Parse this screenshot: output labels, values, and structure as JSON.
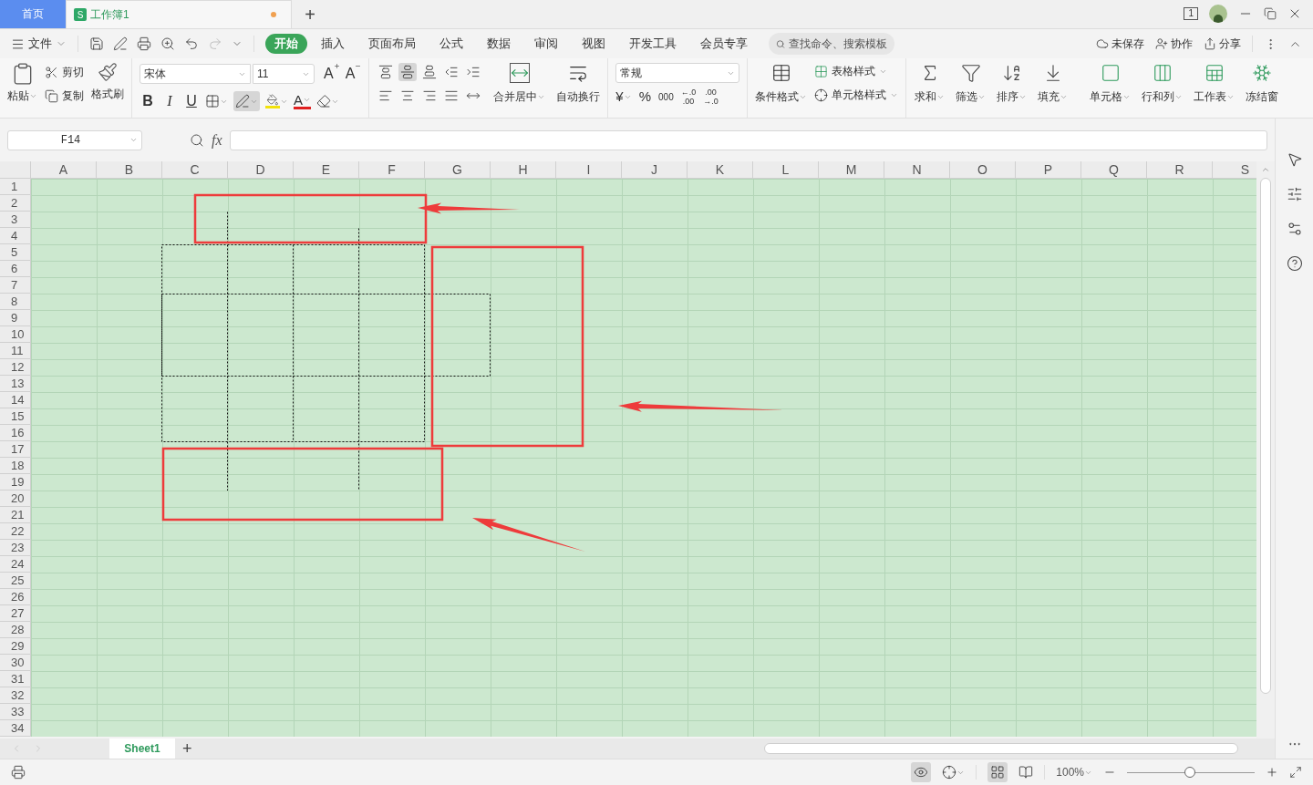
{
  "title_bar": {
    "home_tab": "首页",
    "document_tab": {
      "badge": "S",
      "title": "工作簿1",
      "unsaved": true
    },
    "new_tab_button": "+",
    "window_count": "1"
  },
  "menu_bar": {
    "file_menu": "文件",
    "tabs": [
      {
        "label": "开始",
        "selected": true
      },
      {
        "label": "插入",
        "selected": false
      },
      {
        "label": "页面布局",
        "selected": false
      },
      {
        "label": "公式",
        "selected": false
      },
      {
        "label": "数据",
        "selected": false
      },
      {
        "label": "审阅",
        "selected": false
      },
      {
        "label": "视图",
        "selected": false
      },
      {
        "label": "开发工具",
        "selected": false
      },
      {
        "label": "会员专享",
        "selected": false
      }
    ],
    "search": {
      "placeholder": "查找命令、搜索模板"
    },
    "actions": [
      {
        "kind": "cloud",
        "label": "未保存"
      },
      {
        "kind": "collab",
        "label": "协作"
      },
      {
        "kind": "share",
        "label": "分享"
      }
    ]
  },
  "ribbon": {
    "clipboard": {
      "paste": "粘贴",
      "cut": "剪切",
      "copy": "复制",
      "format_painter": "格式刷"
    },
    "font": {
      "name": "宋体",
      "size": "11",
      "grow": "A",
      "shrink": "A",
      "bold": "B",
      "italic": "I",
      "underline": "U",
      "font_color_letter": "A",
      "draw_border_selected": true
    },
    "align_top_row": [
      {
        "kind": "top",
        "selected": false
      },
      {
        "kind": "middle",
        "selected": true
      },
      {
        "kind": "bottom",
        "selected": false
      },
      {
        "kind": "outdent",
        "selected": false
      },
      {
        "kind": "indent",
        "selected": false
      }
    ],
    "merge": "合并居中",
    "wrap": "自动换行",
    "number": {
      "format": "常规",
      "currency": "¥",
      "percent": "%",
      "thousands": "000",
      "decimals": [
        {
          "top": "←.0",
          "bottom": ".00"
        },
        {
          "top": ".00",
          "bottom": "→.0"
        }
      ]
    },
    "conditional_format": "条件格式",
    "table_style": "表格样式",
    "cell_style": "单元格样式",
    "tools": [
      {
        "kind": "sum",
        "label": "求和"
      },
      {
        "kind": "filter",
        "label": "筛选"
      },
      {
        "kind": "sort",
        "label": "排序"
      },
      {
        "kind": "fill",
        "label": "填充"
      },
      {
        "kind": "cell",
        "label": "单元格"
      },
      {
        "kind": "rowcol",
        "label": "行和列"
      },
      {
        "kind": "sheet",
        "label": "工作表"
      },
      {
        "kind": "freeze",
        "label": "冻结窗"
      }
    ]
  },
  "formula_bar": {
    "name_box": "F14",
    "function_label": "fx"
  },
  "sheet": {
    "columns": [
      "A",
      "B",
      "C",
      "D",
      "E",
      "F",
      "G",
      "H",
      "I",
      "J",
      "K",
      "L",
      "M",
      "N",
      "O",
      "P",
      "Q",
      "R",
      "S"
    ],
    "rows": [
      "1",
      "2",
      "3",
      "4",
      "5",
      "6",
      "7",
      "8",
      "9",
      "10",
      "11",
      "12",
      "13",
      "14",
      "15",
      "16",
      "17",
      "18",
      "19",
      "20",
      "21",
      "22",
      "23",
      "24",
      "25",
      "26",
      "27",
      "28",
      "29",
      "30",
      "31",
      "32",
      "33",
      "34"
    ]
  },
  "sheet_tabs": [
    {
      "label": "Sheet1",
      "selected": true
    }
  ],
  "add_sheet": "+",
  "status_bar": {
    "eye_protection_on": true,
    "normal_view_selected": true,
    "zoom": "100%",
    "zoom_slider": {
      "level": 0.49
    }
  }
}
